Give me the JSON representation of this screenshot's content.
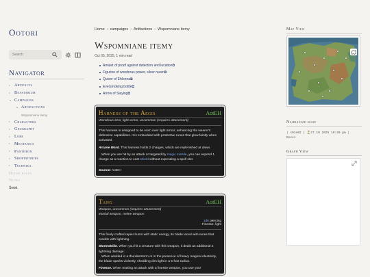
{
  "site": {
    "name": "Ootori"
  },
  "search": {
    "placeholder": "Search"
  },
  "navigator": {
    "title": "Navigator",
    "items": [
      {
        "label": "Artifacts",
        "chev": "›"
      },
      {
        "label": "Beastarium",
        "chev": "›"
      },
      {
        "label": "Campaigns",
        "chev": "⌄"
      },
      {
        "label": "Artifactions",
        "chev": "⌄"
      },
      {
        "label": "Wspomniane itemy"
      },
      {
        "label": "Characters",
        "chev": "›"
      },
      {
        "label": "Geography",
        "chev": "›"
      },
      {
        "label": "Lore",
        "chev": "›"
      },
      {
        "label": "Mechanics",
        "chev": "›"
      },
      {
        "label": "Pantheon",
        "chev": "›"
      },
      {
        "label": "Shortstories",
        "chev": "›"
      },
      {
        "label": "Technika",
        "chev": "›"
      },
      {
        "label": "House rules"
      },
      {
        "label": "Notes"
      },
      {
        "label": "Świat"
      }
    ]
  },
  "breadcrumbs": [
    "Home",
    "campaigns",
    "Artifactions",
    "Wspomniane itemy"
  ],
  "breadcrumb_sep": "›",
  "page": {
    "title": "Wspomniane itemy",
    "meta": "Oct 05, 2025, 1 min read"
  },
  "toc": [
    "Amulet of proof against detection and location",
    "Figurine of wondrous power, silver raven",
    "Quiver of Ehlonna",
    "Eversmoking bottle",
    "Arrow of Slaying"
  ],
  "toc_marker": "⧉",
  "card1": {
    "name": "Harness of the Aegis",
    "source": "AotEH",
    "type": "Wondrous item, light armor, uncommon (requires attunement)",
    "p1": "This harness is designed to be worn over light armor, enhancing the wearer's defensive capabilities. It is embedded with protective runes that glow faintly when activated.",
    "p2_title": "Arcane Ward.",
    "p2": " This harness holds 2 charges, which are replenished at dawn.",
    "p3a": "When you are hit by an attack or targeted by ",
    "p3_link1": "magic missile",
    "p3b": ", you can expend 1 charge as a reaction to cast ",
    "p3_link2": "shield",
    "p3c": " without expending a spell slot.",
    "source_label": "Source:",
    "source_value": " AotEH"
  },
  "card2": {
    "name": "Tang",
    "source": "AotEH",
    "type": "Weapon, uncommon (requires attunement)",
    "subtype": "Martial weapon, melee weapon",
    "damage_dice": "1d6",
    "damage_type": " piercing",
    "properties": "Finesse, light",
    "p1": "This finely crafted rapier hums with static energy, its blade laced with runes that crackle with lightning.",
    "p2_title": "Stormstrike.",
    "p2": " When you hit a creature with this weapon, it deals an additional 2 lightning damage.",
    "p3": "When wielded in a thunderstorm or in the presence of heavy magical electricity, the blade sparks violently, shedding dim light in a 5-foot radius.",
    "p4_title": "Finesse.",
    "p4": " When making an attack with a finesse weapon, you use your"
  },
  "right": {
    "map_title": "Map View",
    "shares_title": "Najbliższe sesje",
    "shares_line1": "| s01e02 | ⏳27.10.2025 10:30 pm |",
    "shares_line2": "Rosci",
    "graph_title": "Graph View"
  }
}
